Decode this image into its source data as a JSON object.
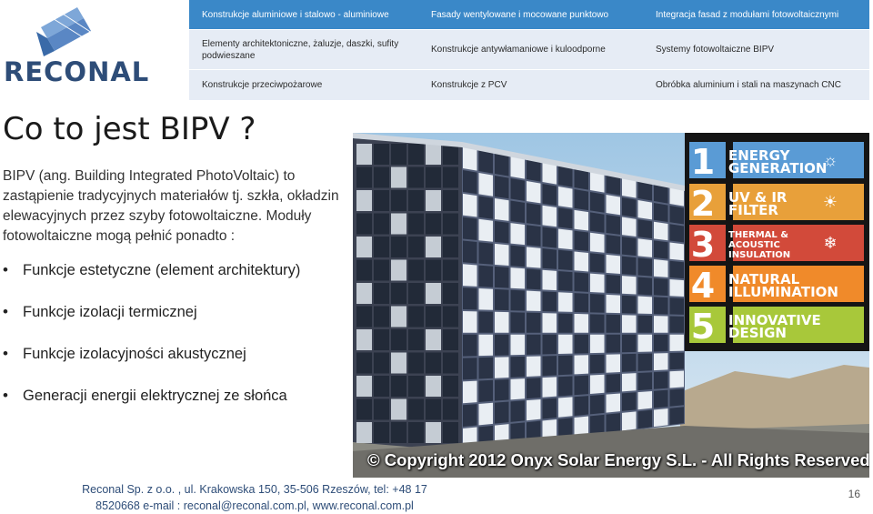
{
  "logo": {
    "text": "RECONAL"
  },
  "top_table": {
    "header": [
      "Konstrukcje aluminiowe i stalowo - aluminiowe",
      "Fasady wentylowane i mocowane punktowo",
      "Integracja fasad z modułami fotowoltaicznymi"
    ],
    "row1": [
      "Elementy architektoniczne, żaluzje, daszki, sufity podwieszane",
      "Konstrukcje antywłamaniowe i kuloodporne",
      "Systemy fotowoltaiczne BIPV"
    ],
    "row2": [
      "Konstrukcje przeciwpożarowe",
      "Konstrukcje z PCV",
      "Obróbka aluminium i stali na maszynach CNC"
    ]
  },
  "slide": {
    "title": "Co to jest BIPV ?",
    "intro": "BIPV (ang. Building Integrated PhotoVoltaic) to zastąpienie tradycyjnych materiałów tj. szkła, okładzin elewacyjnych przez szyby fotowoltaiczne. Moduły fotowoltaiczne mogą pełnić ponadto :",
    "bullets": [
      "Funkcje estetyczne (element architektury)",
      "Funkcje izolacji termicznej",
      "Funkcje izolacyjności akustycznej",
      "Generacji energii elektrycznej ze słońca"
    ]
  },
  "photo": {
    "copyright": "© Copyright 2012 Onyx Solar Energy S.L. - All Rights Reserved",
    "features": [
      {
        "num": "1",
        "label": "ENERGY GENERATION",
        "color": "#5a9bd5",
        "icon": "bulb-icon"
      },
      {
        "num": "2",
        "label": "UV & IR FILTER",
        "color": "#e8a03a",
        "icon": "sun-icon"
      },
      {
        "num": "3",
        "label": "THERMAL & ACOUSTIC INSULATION",
        "color": "#d24a3a",
        "icon": "fire-snow-icon"
      },
      {
        "num": "4",
        "label": "NATURAL ILLUMINATION",
        "color": "#f08a2a",
        "icon": ""
      },
      {
        "num": "5",
        "label": "INNOVATIVE DESIGN",
        "color": "#a8c83a",
        "icon": ""
      }
    ]
  },
  "footer": {
    "address": "Reconal Sp. z o.o. , ul. Krakowska 150, 35-506 Rzeszów, tel: +48 17 8520668 e-mail : reconal@reconal.com.pl, www.reconal.com.pl",
    "page": "16"
  },
  "colors": {
    "header_blue": "#3a88c8",
    "row_bg": "#e6ecf5",
    "brand": "#2e4d78"
  }
}
